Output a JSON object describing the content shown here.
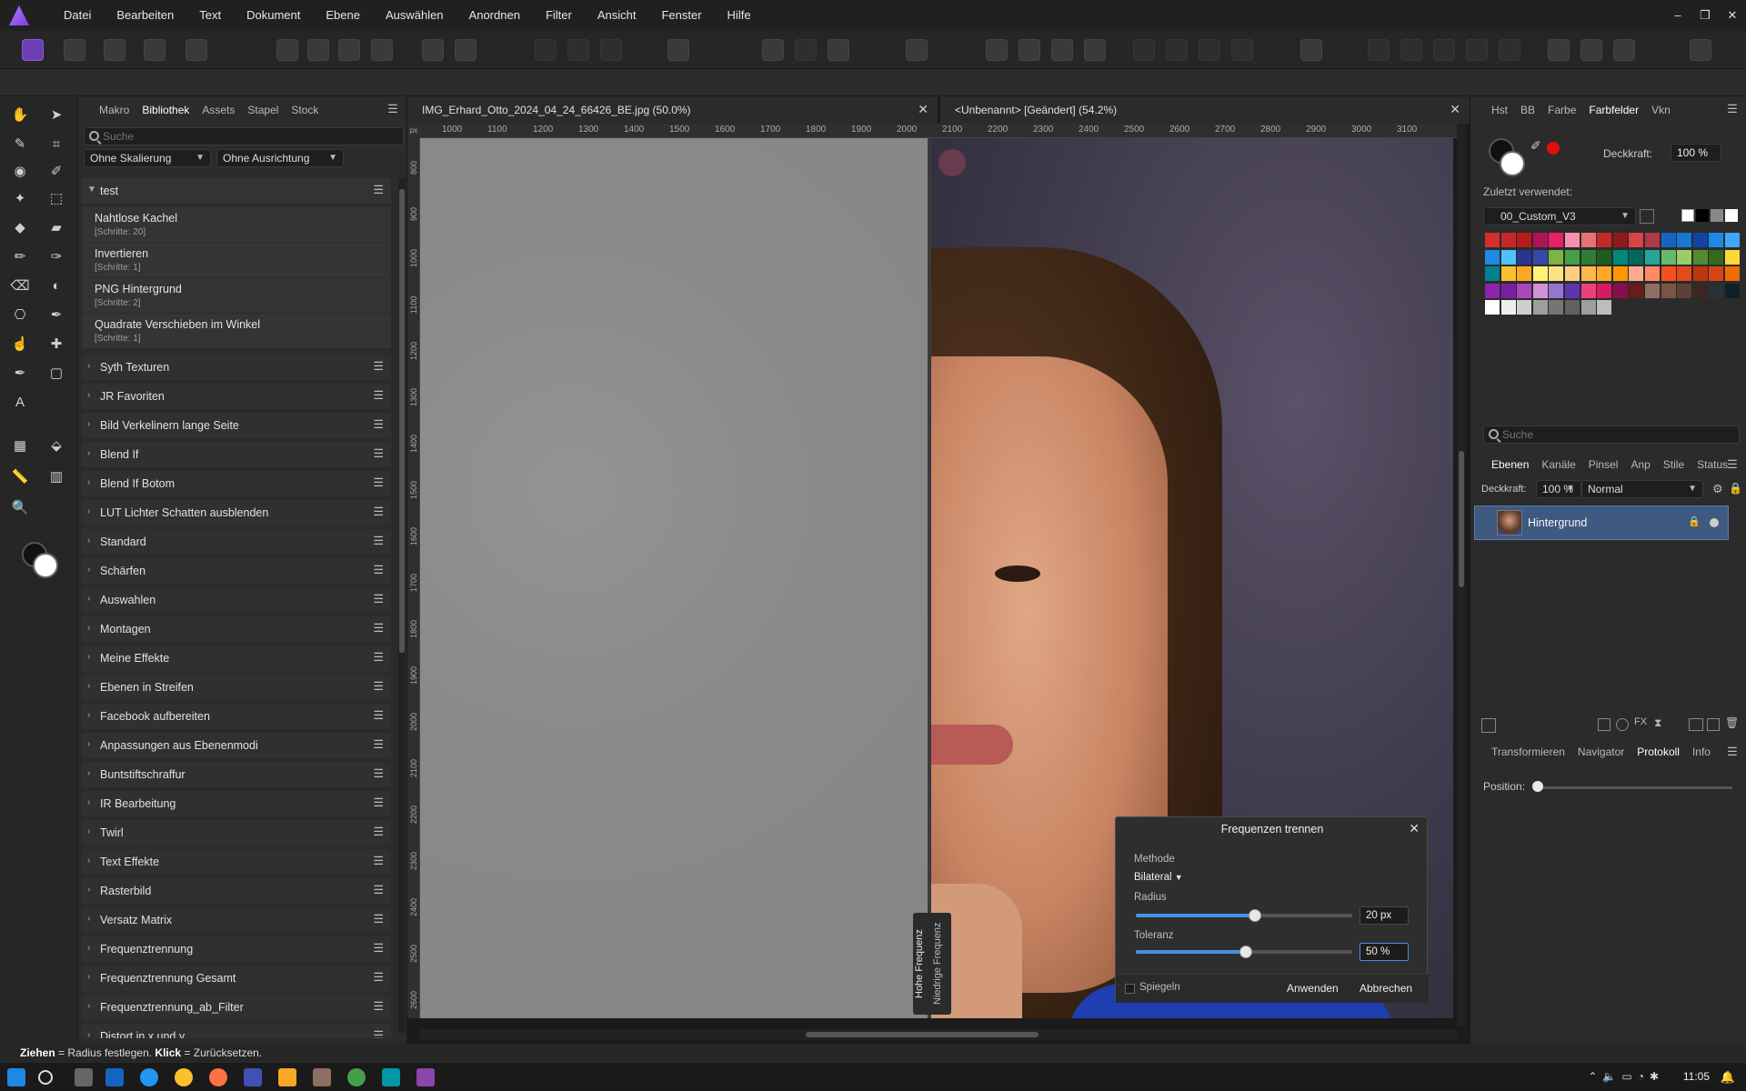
{
  "menu": {
    "items": [
      "Datei",
      "Bearbeiten",
      "Text",
      "Dokument",
      "Ebene",
      "Auswählen",
      "Anordnen",
      "Filter",
      "Ansicht",
      "Fenster",
      "Hilfe"
    ]
  },
  "window_controls": {
    "minimize": "–",
    "restore": "❐",
    "close": "✕"
  },
  "left_panel": {
    "tabs": [
      "Makro",
      "Bibliothek",
      "Assets",
      "Stapel",
      "Stock"
    ],
    "active_tab": "Bibliothek",
    "search_placeholder": "Suche",
    "scaling_dropdown": "Ohne Skalierung",
    "alignment_dropdown": "Ohne Ausrichtung",
    "open_category": "test",
    "macros": [
      {
        "name": "Nahtlose Kachel",
        "steps": "[Schritte: 20]"
      },
      {
        "name": "Invertieren",
        "steps": "[Schritte: 1]"
      },
      {
        "name": "PNG Hintergrund",
        "steps": "[Schritte: 2]"
      },
      {
        "name": "Quadrate Verschieben im Winkel",
        "steps": "[Schritte: 1]"
      }
    ],
    "categories": [
      "Syth Texturen",
      "JR Favoriten",
      "Bild Verkelinern lange Seite",
      "Blend If",
      "Blend If Botom",
      "LUT Lichter Schatten ausblenden",
      "Standard",
      "Schärfen",
      "Auswahlen",
      "Montagen",
      "Meine Effekte",
      "Ebenen in Streifen",
      "Facebook aufbereiten",
      "Anpassungen aus Ebenenmodi",
      "Buntstiftschraffur",
      "IR Bearbeitung",
      "Twirl",
      "Text Effekte",
      "Rasterbild",
      "Versatz Matrix",
      "Frequenztrennung",
      "Frequenztrennung Gesamt",
      "Frequenztrennung_ab_Filter",
      "Distort in x und y"
    ]
  },
  "documents": {
    "tab1_title": "IMG_Erhard_Otto_2024_04_24_66426_BE.jpg (50.0%)",
    "tab2_title": "<Unbenannt> [Geändert] (54.2%)",
    "ruler_unit": "px",
    "hruler_labels": [
      "1000",
      "1100",
      "1200",
      "1300",
      "1400",
      "1500",
      "1600",
      "1700",
      "1800",
      "1900",
      "2000",
      "2100",
      "2200",
      "2300",
      "2400",
      "2500",
      "2600",
      "2700",
      "2800",
      "2900",
      "3000",
      "3100"
    ],
    "vruler_labels": [
      "800",
      "900",
      "1000",
      "1100",
      "1200",
      "1300",
      "1400",
      "1500",
      "1600",
      "1700",
      "1800",
      "1900",
      "2000",
      "2100",
      "2200",
      "2300",
      "2400",
      "2500",
      "2600"
    ],
    "split_high": "Hohe Frequenz",
    "split_low": "Niedrige Frequenz"
  },
  "dialog": {
    "title": "Frequenzen trennen",
    "method_label": "Methode",
    "method_value": "Bilateral",
    "radius_label": "Radius",
    "radius_value": "20 px",
    "radius_fraction": 0.55,
    "tolerance_label": "Toleranz",
    "tolerance_value": "50 %",
    "tolerance_fraction": 0.51,
    "mirror_label": "Spiegeln",
    "apply": "Anwenden",
    "cancel": "Abbrechen"
  },
  "right_panel": {
    "tabs_top": [
      "Hst",
      "BB",
      "Farbe",
      "Farbfelder",
      "Vkn"
    ],
    "active_top": "Farbfelder",
    "opacity_label": "Deckkraft:",
    "opacity_value": "100 %",
    "recent_label": "Zuletzt verwendet:",
    "palette_name": "00_Custom_V3",
    "swatch_colors": [
      "#d32f2f",
      "#c62828",
      "#b71c1c",
      "#ad1457",
      "#e91e63",
      "#f48fb1",
      "#e57373",
      "#c62828",
      "#8e1a1a",
      "#d84343",
      "#b03a48",
      "#1565c0",
      "#1976d2",
      "#0d47a1",
      "#1e88e5",
      "#42a5f5",
      "#1e88e5",
      "#4fc3f7",
      "#283593",
      "#3949ab",
      "#7cb342",
      "#43a047",
      "#2e7d32",
      "#1b5e20",
      "#00897b",
      "#00695c",
      "#26a69a",
      "#66bb6a",
      "#9ccc65",
      "#558b2f",
      "#33691e",
      "#fdd835",
      "#00838f",
      "#fbc02d",
      "#f9a825",
      "#fff176",
      "#ffe082",
      "#ffcc80",
      "#ffb74d",
      "#ffa726",
      "#ff9800",
      "#ffab91",
      "#ff8a65",
      "#f4511e",
      "#e64a19",
      "#bf360c",
      "#d84315",
      "#ef6c00",
      "#8e24aa",
      "#7b1fa2",
      "#ab47bc",
      "#ce93d8",
      "#9575cd",
      "#5e35b1",
      "#ec407a",
      "#d81b60",
      "#880e4f",
      "#6a1b1b",
      "#8d6e63",
      "#795548",
      "#5d4037",
      "#3e2723",
      "#263238",
      "#102027",
      "#ffffff",
      "#eeeeee",
      "#cfcfcf",
      "#9e9e9e",
      "#757575",
      "#616161",
      "#9e9e9e",
      "#bdbdbd"
    ],
    "search_placeholder": "Suche",
    "layer_tabs": [
      "Ebenen",
      "Kanäle",
      "Pinsel",
      "Anp",
      "Stile",
      "Status"
    ],
    "active_layer_tab": "Ebenen",
    "layer_opacity_label": "Deckkraft:",
    "layer_opacity_value": "100 %",
    "blend_mode": "Normal",
    "layer_name": "Hintergrund",
    "bottom_tabs": [
      "Transformieren",
      "Navigator",
      "Protokoll",
      "Info"
    ],
    "active_bottom_tab": "Protokoll",
    "position_label": "Position:"
  },
  "status": {
    "drag_key": "Ziehen",
    "drag_text": " = Radius festlegen. ",
    "click_key": "Klick",
    "click_text": " = Zurücksetzen."
  },
  "taskbar": {
    "time": "11:05"
  }
}
